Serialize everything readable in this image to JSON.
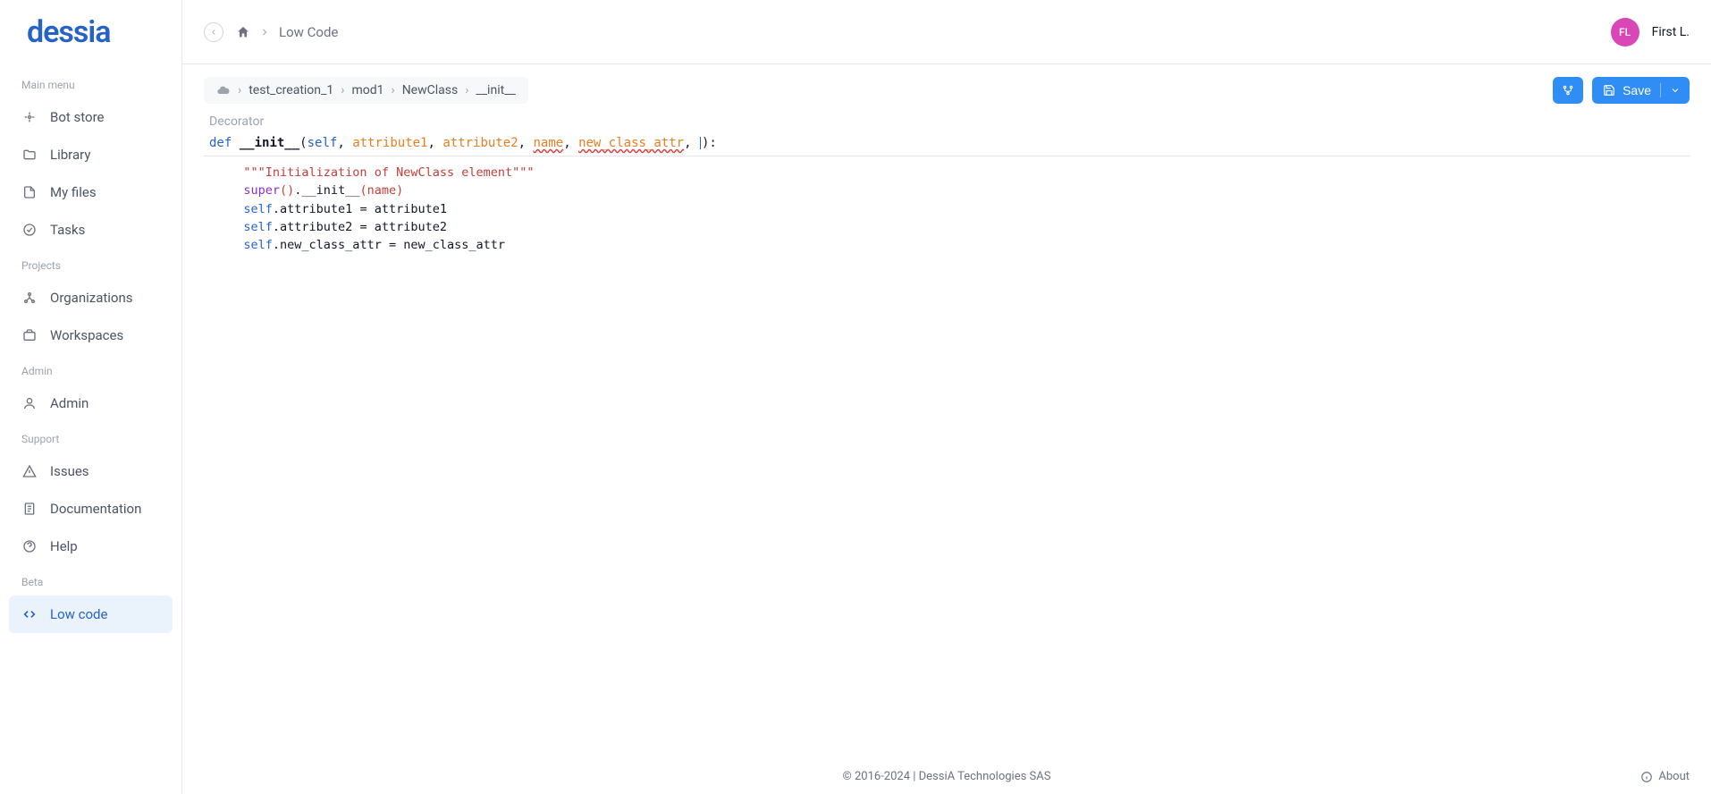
{
  "logo": {
    "text": "dessia"
  },
  "header": {
    "breadcrumb_current": "Low Code",
    "user_initials": "FL",
    "user_name": "First L."
  },
  "sidebar": {
    "sections": [
      {
        "label": "Main menu"
      },
      {
        "label": "Projects"
      },
      {
        "label": "Admin"
      },
      {
        "label": "Support"
      },
      {
        "label": "Beta"
      }
    ],
    "items": {
      "bot_store": "Bot store",
      "library": "Library",
      "my_files": "My files",
      "tasks": "Tasks",
      "organizations": "Organizations",
      "workspaces": "Workspaces",
      "admin": "Admin",
      "issues": "Issues",
      "documentation": "Documentation",
      "help": "Help",
      "low_code": "Low code"
    }
  },
  "toolbar": {
    "crumbs": [
      "test_creation_1",
      "mod1",
      "NewClass",
      "__init__"
    ],
    "save_label": "Save"
  },
  "editor": {
    "decorator_label": "Decorator",
    "signature": {
      "def": "def",
      "name": "__init__",
      "args_self": "self",
      "args": [
        "attribute1",
        "attribute2"
      ],
      "args_warn": [
        "name",
        "new_class_attr"
      ]
    },
    "code": {
      "docstring": "\"\"\"Initialization of NewClass element\"\"\"",
      "l2_super": "super",
      "l2_init": ".__init__",
      "l2_arg": "(name)",
      "l3_self": "self",
      "l3_rest": ".attribute1 = attribute1",
      "l4_self": "self",
      "l4_rest": ".attribute2 = attribute2",
      "l5_self": "self",
      "l5_rest": ".new_class_attr = new_class_attr"
    }
  },
  "footer": {
    "copyright": "© 2016-2024 | DessiA Technologies SAS",
    "about": "About"
  }
}
